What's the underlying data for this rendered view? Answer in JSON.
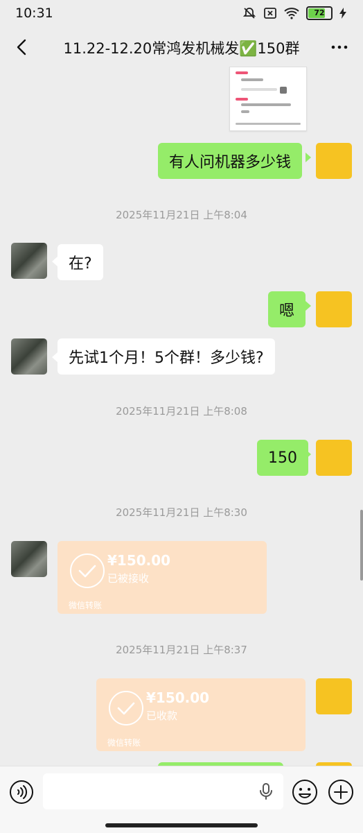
{
  "status_bar": {
    "time": "10:31",
    "battery": "72"
  },
  "header": {
    "title": "11.22-12.20常鸿发机械发✅150群"
  },
  "messages": {
    "m1": "有人问机器多少钱",
    "t1": "2025年11月21日 上午8:04",
    "m2": "在?",
    "m3": "嗯",
    "m4": "先试1个月！5个群！多少钱?",
    "t2": "2025年11月21日 上午8:08",
    "m5": "150",
    "t3": "2025年11月21日 上午8:30",
    "transfer1": {
      "amount": "¥150.00",
      "status": "已被接收",
      "label": "微信转账"
    },
    "t4": "2025年11月21日 上午8:37",
    "transfer2": {
      "amount": "¥150.00",
      "status": "已收款",
      "label": "微信转账"
    }
  },
  "colors": {
    "outgoing_bubble": "#95ec69",
    "incoming_bubble": "#ffffff",
    "transfer_card": "#fde1c6",
    "chat_bg": "#ededed"
  },
  "icons": [
    "back-arrow-icon",
    "more-icon",
    "voice-icon",
    "mic-icon",
    "emoji-icon",
    "plus-icon"
  ]
}
